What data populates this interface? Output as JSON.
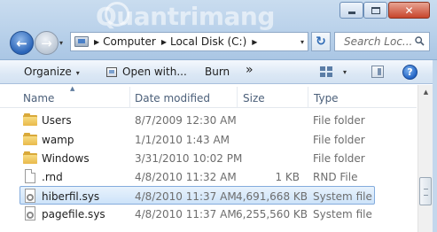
{
  "watermark": {
    "text": "Quantrimang"
  },
  "window": {
    "minimize": "",
    "maximize": "",
    "close": "✕"
  },
  "nav": {
    "back_glyph": "←",
    "forward_glyph": "→",
    "dropdown_glyph": "▾"
  },
  "address": {
    "crumbs": [
      "Computer",
      "Local Disk (C:)"
    ],
    "separator": "▶",
    "dropdown_glyph": "▾",
    "refresh_glyph": "↻"
  },
  "search": {
    "placeholder": "Search Loc..."
  },
  "toolbar": {
    "organize_label": "Organize",
    "open_with_label": "Open with...",
    "burn_label": "Burn",
    "more_label": "»",
    "caret": "▾",
    "help_label": "?"
  },
  "columns": {
    "name": "Name",
    "date": "Date modified",
    "size": "Size",
    "type": "Type",
    "sort_indicator": "▲"
  },
  "files": [
    {
      "icon": "folder-icon",
      "name": "Users",
      "date": "8/7/2009 12:30 AM",
      "size": "",
      "type": "File folder",
      "selected": false
    },
    {
      "icon": "folder-icon",
      "name": "wamp",
      "date": "1/1/2010 1:43 AM",
      "size": "",
      "type": "File folder",
      "selected": false
    },
    {
      "icon": "folder-icon",
      "name": "Windows",
      "date": "3/31/2010 10:02 PM",
      "size": "",
      "type": "File folder",
      "selected": false
    },
    {
      "icon": "file-icon",
      "name": ".rnd",
      "date": "4/8/2010 11:32 AM",
      "size": "1 KB",
      "type": "RND File",
      "selected": false
    },
    {
      "icon": "system-file-icon",
      "name": "hiberfil.sys",
      "date": "4/8/2010 11:37 AM",
      "size": "4,691,668 KB",
      "type": "System file",
      "selected": true
    },
    {
      "icon": "system-file-icon",
      "name": "pagefile.sys",
      "date": "4/8/2010 11:37 AM",
      "size": "6,255,560 KB",
      "type": "System file",
      "selected": false
    }
  ],
  "scrollbar": {
    "up_glyph": "▲"
  },
  "colors": {
    "chrome": "#b9d1ea",
    "selection": "#cde3f9",
    "header_text": "#4c607a",
    "folder": "#e9b94b"
  }
}
